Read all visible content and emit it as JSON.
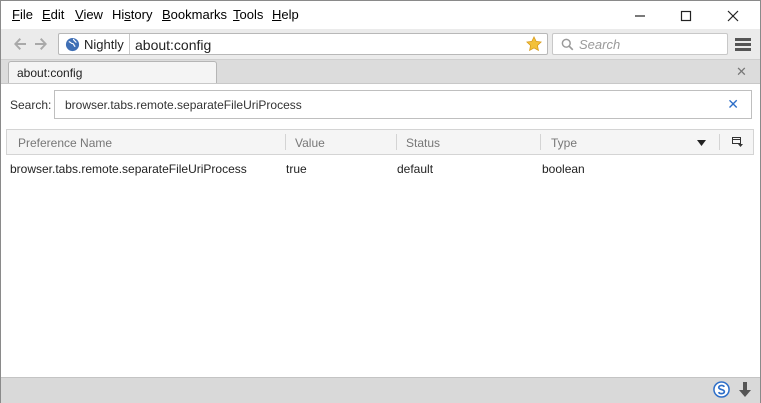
{
  "menubar": {
    "items": [
      {
        "label": "File",
        "ul": "F",
        "rest": "ile"
      },
      {
        "label": "Edit",
        "ul": "E",
        "rest": "dit"
      },
      {
        "label": "View",
        "ul": "V",
        "rest": "iew"
      },
      {
        "label": "History",
        "ul": "s",
        "pre": "Hi",
        "rest": "tory"
      },
      {
        "label": "Bookmarks",
        "ul": "B",
        "rest": "ookmarks"
      },
      {
        "label": "Tools",
        "ul": "T",
        "rest": "ools"
      },
      {
        "label": "Help",
        "ul": "H",
        "rest": "elp"
      }
    ]
  },
  "navbar": {
    "identity_label": "Nightly",
    "url": "about:config",
    "search_placeholder": "Search"
  },
  "tabs": [
    {
      "label": "about:config"
    }
  ],
  "config": {
    "search_label": "Search:",
    "search_value": "browser.tabs.remote.separateFileUriProcess",
    "columns": [
      "Preference Name",
      "Value",
      "Status",
      "Type"
    ],
    "rows": [
      {
        "name": "browser.tabs.remote.separateFileUriProcess",
        "value": "true",
        "status": "default",
        "type": "boolean"
      }
    ]
  },
  "colors": {
    "accent_blue": "#2d6ec8",
    "star": "#f0b429"
  },
  "icons": [
    "back-arrow-icon",
    "forward-arrow-icon",
    "globe-icon",
    "star-icon",
    "search-icon",
    "hamburger-icon",
    "close-icon",
    "column-picker-icon",
    "s-badge-icon",
    "download-arrow-icon"
  ]
}
